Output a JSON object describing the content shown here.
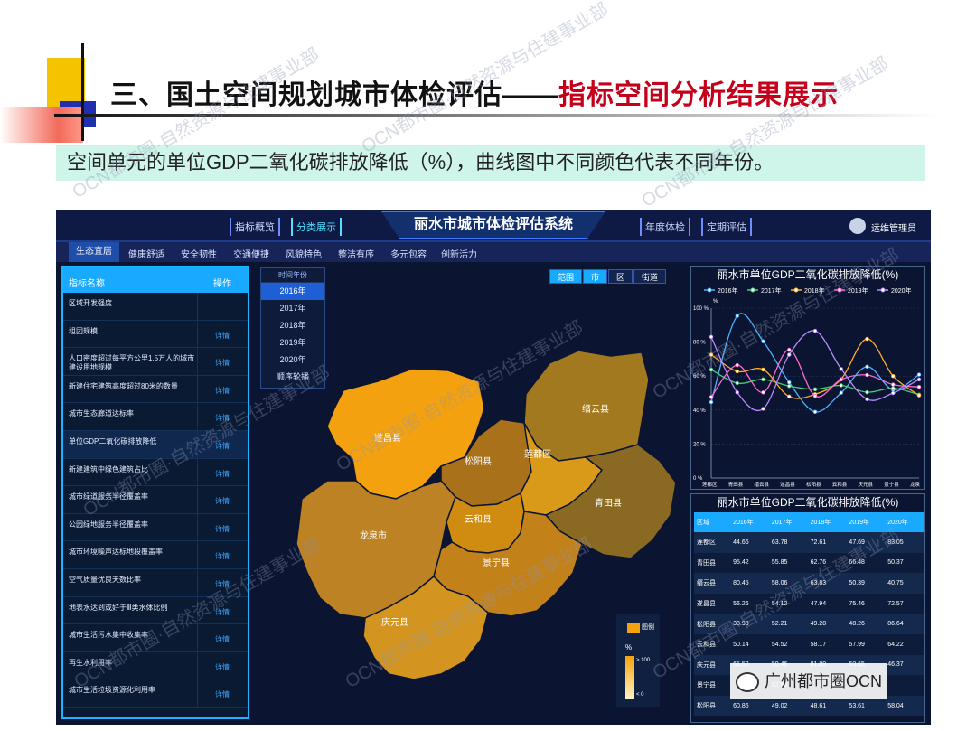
{
  "slide": {
    "title_main": "三、国土空间规划城市体检评估——",
    "title_highlight": "指标空间分析结果展示",
    "caption": "空间单元的单位GDP二氧化碳排放降低（%），曲线图中不同颜色代表不同年份。"
  },
  "topbar": {
    "pills": [
      "指标概览",
      "分类展示",
      "年度体检",
      "定期评估"
    ],
    "system_title": "丽水市城市体检评估系统",
    "user": "运维管理员"
  },
  "nav": [
    "生态宜居",
    "健康舒适",
    "安全韧性",
    "交通便捷",
    "风貌特色",
    "整洁有序",
    "多元包容",
    "创新活力"
  ],
  "left_panel": {
    "col_name": "指标名称",
    "col_op": "操作",
    "rows": [
      {
        "name": "区域开发强度",
        "op": ""
      },
      {
        "name": "组团规模",
        "op": "详情"
      },
      {
        "name": "人口密度超过每平方公里1.5万人的城市建设用地规模",
        "op": "详情"
      },
      {
        "name": "新建住宅建筑高度超过80米的数量",
        "op": "详情"
      },
      {
        "name": "城市生态廊道达标率",
        "op": "详情"
      },
      {
        "name": "单位GDP二氧化碳排放降低",
        "op": "详情"
      },
      {
        "name": "新建建筑中绿色建筑占比",
        "op": "详情"
      },
      {
        "name": "城市绿道服务半径覆盖率",
        "op": "详情"
      },
      {
        "name": "公园绿地服务半径覆盖率",
        "op": "详情"
      },
      {
        "name": "城市环境噪声达标地段覆盖率",
        "op": "详情"
      },
      {
        "name": "空气质量优良天数比率",
        "op": "详情"
      },
      {
        "name": "地表水达到或好于Ⅲ类水体比例",
        "op": "详情"
      },
      {
        "name": "城市生活污水集中收集率",
        "op": "详情"
      },
      {
        "name": "再生水利用率",
        "op": "详情"
      },
      {
        "name": "城市生活垃圾资源化利用率",
        "op": "详情"
      }
    ]
  },
  "years": {
    "header": "时间年份",
    "items": [
      "2016年",
      "2017年",
      "2018年",
      "2019年",
      "2020年",
      "顺序轮播"
    ],
    "selected": 0
  },
  "filters": [
    "范围",
    "市",
    "区",
    "街道"
  ],
  "map": {
    "regions": [
      "遂昌县",
      "松阳县",
      "莲都区",
      "缙云县",
      "龙泉市",
      "云和县",
      "青田县",
      "景宁县",
      "庆元县"
    ],
    "colors": {
      "遂昌县": "#f3a10e",
      "松阳县": "#a9721a",
      "莲都区": "#d99a1a",
      "缙云县": "#a3791f",
      "龙泉市": "#bc8223",
      "云和县": "#d08c10",
      "青田县": "#8a6a22",
      "景宁县": "#c38219",
      "庆元县": "#d49520"
    },
    "legend_title": "图例",
    "legend_unit": "%",
    "legend_max": "> 100",
    "legend_min": "< 0"
  },
  "chart_panel": {
    "title": "丽水市单位GDP二氧化碳排放降低(%)",
    "ylabel": "%",
    "toolbar": [
      "≣",
      "↓",
      "⚙"
    ]
  },
  "chart_data": {
    "type": "line",
    "title": "丽水市单位GDP二氧化碳排放降低(%)",
    "ylabel": "%",
    "ylim": [
      0,
      100
    ],
    "yticks": [
      "0 %",
      "20 %",
      "40 %",
      "60 %",
      "80 %",
      "100 %"
    ],
    "categories": [
      "莲都区",
      "青田县",
      "缙云县",
      "遂昌县",
      "松阳县",
      "云和县",
      "庆元县",
      "景宁县",
      "龙泉"
    ],
    "series": [
      {
        "name": "2016年",
        "color": "#4fb3ff",
        "values": [
          44.66,
          95.42,
          80.45,
          56.26,
          38.93,
          50.14,
          65.53,
          52,
          60.86
        ]
      },
      {
        "name": "2017年",
        "color": "#45d07a",
        "values": [
          63.78,
          55.85,
          58.06,
          54.12,
          52.21,
          54.52,
          50.46,
          52.85,
          49.02
        ]
      },
      {
        "name": "2018年",
        "color": "#ffb020",
        "values": [
          72.61,
          62.76,
          63.83,
          47.94,
          49.28,
          58.17,
          81.89,
          60,
          48.61
        ]
      },
      {
        "name": "2019年",
        "color": "#ff6bd0",
        "values": [
          47.69,
          66.48,
          50.39,
          75.46,
          48.26,
          57.99,
          60.65,
          55,
          53.61
        ]
      },
      {
        "name": "2020年",
        "color": "#b98cff",
        "values": [
          83.05,
          50.37,
          40.75,
          72.57,
          86.64,
          64.22,
          46.37,
          50,
          58.04
        ]
      }
    ],
    "legend": "top"
  },
  "table_panel": {
    "title": "丽水市单位GDP二氧化碳排放降低(%)",
    "headers": [
      "区域",
      "2016年",
      "2017年",
      "2018年",
      "2019年",
      "2020年"
    ],
    "rows": [
      [
        "莲都区",
        "44.66",
        "63.78",
        "72.61",
        "47.69",
        "83.05"
      ],
      [
        "青田县",
        "95.42",
        "55.85",
        "62.76",
        "66.48",
        "50.37"
      ],
      [
        "缙云县",
        "80.45",
        "58.06",
        "63.83",
        "50.39",
        "40.75"
      ],
      [
        "遂昌县",
        "56.26",
        "54.12",
        "47.94",
        "75.46",
        "72.57"
      ],
      [
        "松阳县",
        "38.93",
        "52.21",
        "49.28",
        "48.26",
        "86.64"
      ],
      [
        "云和县",
        "50.14",
        "54.52",
        "58.17",
        "57.99",
        "64.22"
      ],
      [
        "庆元县",
        "65.53",
        "50.46",
        "81.89",
        "60.65",
        "46.37"
      ],
      [
        "景宁县",
        "",
        "52.85",
        "",
        "",
        ""
      ],
      [
        "松阳县",
        "60.86",
        "49.02",
        "48.61",
        "53.61",
        "58.04"
      ]
    ]
  },
  "watermark": "OCN都市圈·自然资源与住建事业部",
  "wechat_badge": "广州都市圈OCN"
}
